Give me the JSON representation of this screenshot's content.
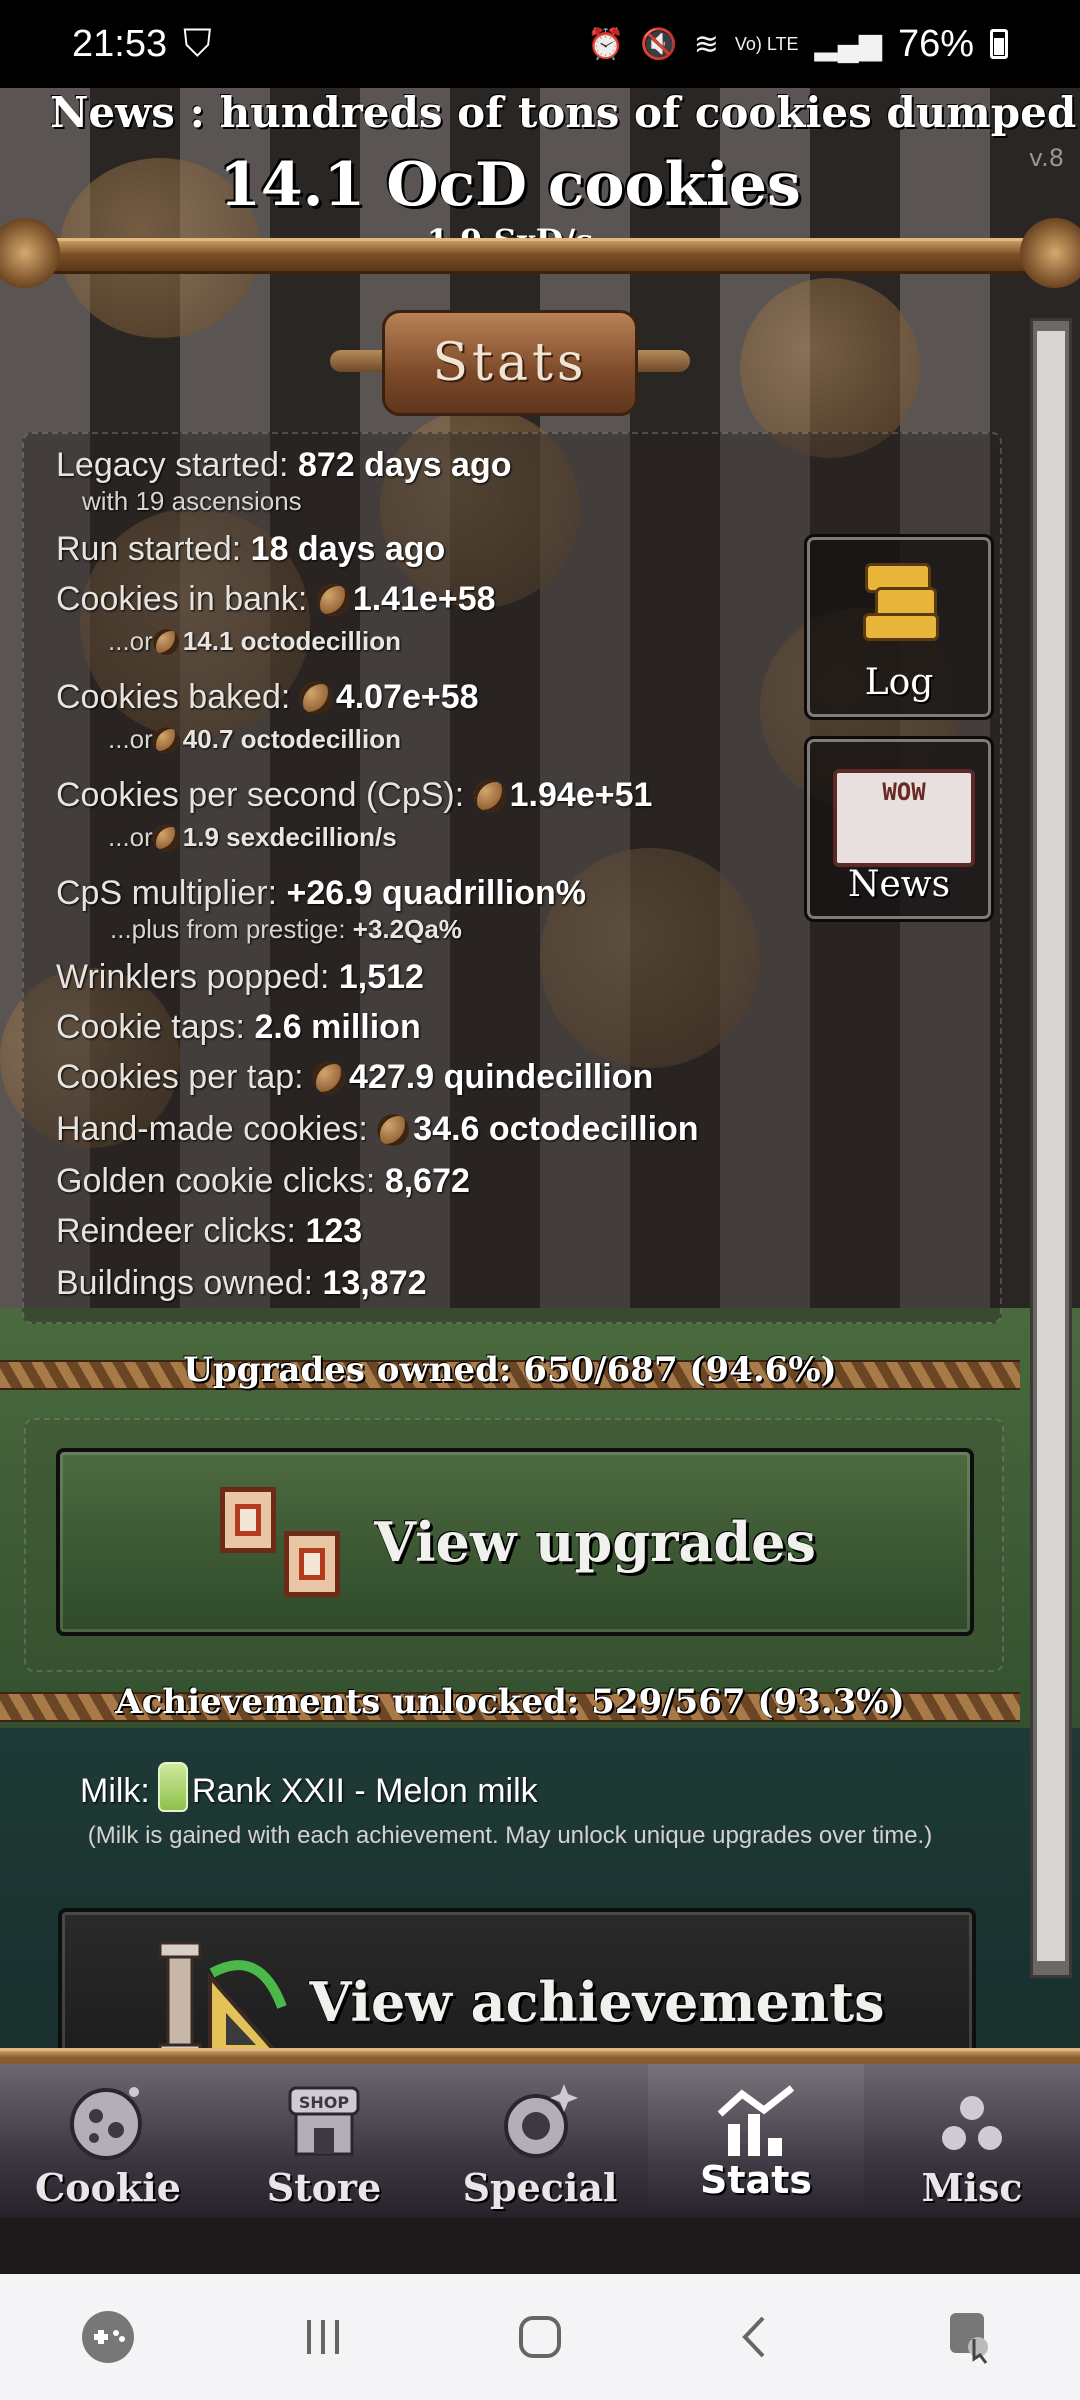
{
  "status_bar": {
    "time": "21:53",
    "battery": "76%",
    "net": "Vo) LTE"
  },
  "header": {
    "news": "News : hundreds of tons of cookies dumped in",
    "version": "v.8",
    "cookies": "14.1 OcD cookies",
    "cps": "1.9 SxD/s"
  },
  "section_title": "Stats",
  "side_buttons": {
    "log": "Log",
    "news": "News",
    "news_icon_text": "WOW"
  },
  "stats": {
    "legacy_label": "Legacy started:",
    "legacy_value": "872 days ago",
    "ascensions": "with 19 ascensions",
    "run_label": "Run started:",
    "run_value": "18 days ago",
    "bank_label": "Cookies in bank:",
    "bank_value": "1.41e+58",
    "bank_or_prefix": "...or",
    "bank_or": "14.1 octodecillion",
    "baked_label": "Cookies baked:",
    "baked_value": "4.07e+58",
    "baked_or_prefix": "...or",
    "baked_or": "40.7 octodecillion",
    "cps_label": "Cookies per second (CpS):",
    "cps_value": "1.94e+51",
    "cps_or_prefix": "...or",
    "cps_or": "1.9 sexdecillion/s",
    "mult_label": "CpS multiplier:",
    "mult_value": "+26.9 quadrillion%",
    "prestige_label": "...plus from prestige:",
    "prestige_value": "+3.2Qa%",
    "wrinklers_label": "Wrinklers popped:",
    "wrinklers_value": "1,512",
    "taps_label": "Cookie taps:",
    "taps_value": "2.6 million",
    "per_tap_label": "Cookies per tap:",
    "per_tap_value": "427.9 quindecillion",
    "handmade_label": "Hand-made cookies:",
    "handmade_value": "34.6 octodecillion",
    "golden_label": "Golden cookie clicks:",
    "golden_value": "8,672",
    "reindeer_label": "Reindeer clicks:",
    "reindeer_value": "123",
    "buildings_label": "Buildings owned:",
    "buildings_value": "13,872"
  },
  "upgrades": {
    "summary": "Upgrades owned: 650/687 (94.6%)",
    "button": "View upgrades"
  },
  "achievements": {
    "summary": "Achievements unlocked: 529/567 (93.3%)",
    "milk_label": "Milk:",
    "milk_value": "Rank XXII - Melon milk",
    "milk_desc": "(Milk is gained with each achievement. May unlock unique upgrades over time.)",
    "button": "View achievements"
  },
  "tabs": [
    {
      "label": "Cookie",
      "icon": "cookie-icon"
    },
    {
      "label": "Store",
      "icon": "shop-icon",
      "icon_text": "SHOP"
    },
    {
      "label": "Special",
      "icon": "special-icon"
    },
    {
      "label": "Stats",
      "icon": "stats-icon",
      "active": true
    },
    {
      "label": "Misc",
      "icon": "misc-icon"
    }
  ],
  "colors": {
    "wood": "#7a4f26",
    "grass": "#4a6a3e",
    "teal": "#1f3a36",
    "tab_bar": "#3c3641"
  }
}
